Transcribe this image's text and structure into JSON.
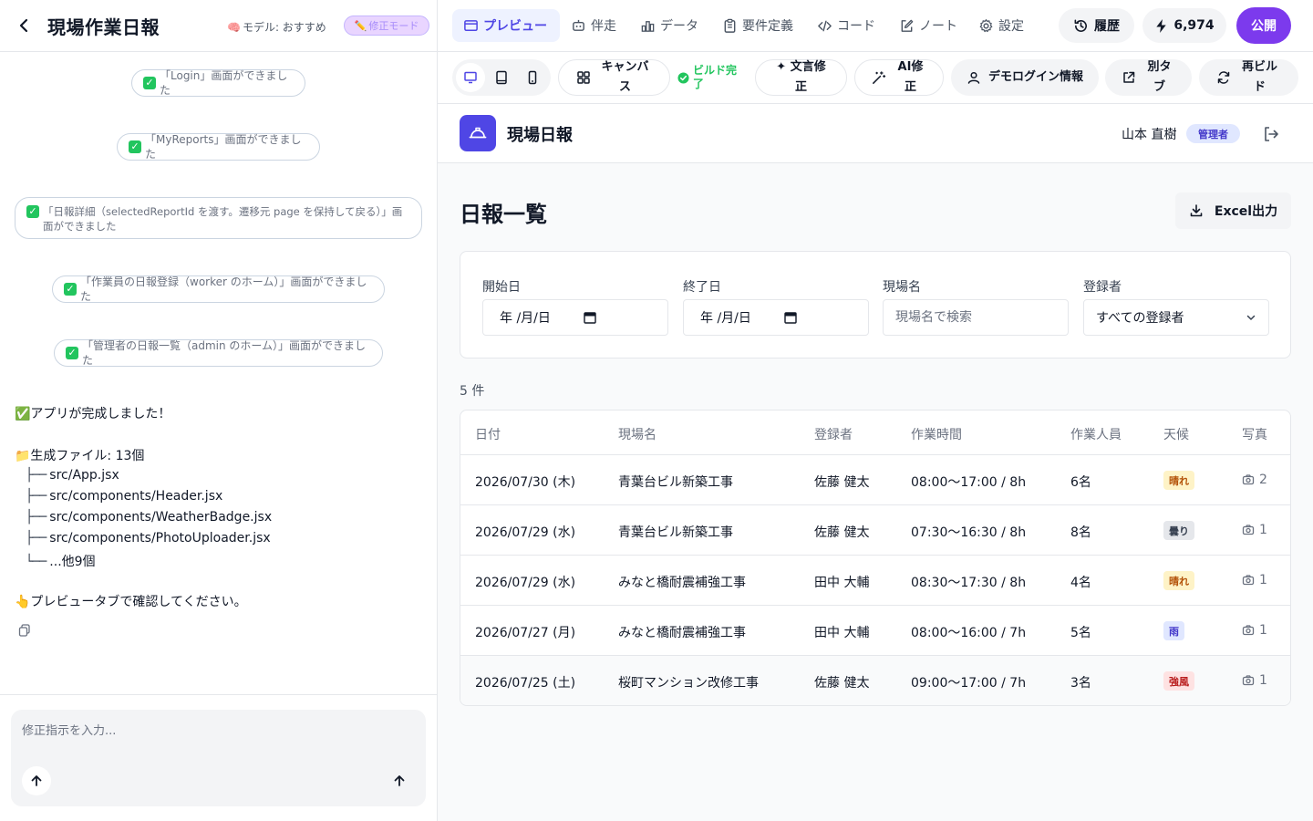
{
  "left": {
    "title": "現場作業日報",
    "model_label": "モデル: おすすめ",
    "fix_mode_label": "修正モード",
    "chat": {
      "pills": [
        "「Login」画面ができました",
        "「MyReports」画面ができました",
        "「日報詳細（selectedReportId を渡す。遷移元 page を保持して戻る）」画面ができました",
        "「作業員の日報登録（worker のホーム）」画面ができました",
        "「管理者の日報一覧（admin のホーム）」画面ができました"
      ],
      "complete": "✅アプリが完成しました！",
      "generated": "📁生成ファイル: 13個",
      "files": [
        "src/App.jsx",
        "src/components/Header.jsx",
        "src/components/WeatherBadge.jsx",
        "src/components/PhotoUploader.jsx",
        "...他9個"
      ],
      "hint": "👆プレビュータブで確認してください。"
    },
    "composer": {
      "placeholder": "修正指示を入力..."
    }
  },
  "topnav": {
    "tabs": [
      "プレビュー",
      "伴走",
      "データ",
      "要件定義",
      "コード",
      "ノート",
      "設定"
    ],
    "history_label": "履歴",
    "credits": "6,974",
    "publish_label": "公開"
  },
  "toolbar": {
    "canvas_label": "キャンバス",
    "build_status": "ビルド完了",
    "copy_fix_label": "文言修正",
    "ai_fix_label": "AI修正",
    "demo_login_label": "デモログイン情報",
    "new_tab_label": "別タブ",
    "rebuild_label": "再ビルド"
  },
  "app": {
    "name": "現場日報",
    "user_name": "山本 直樹",
    "role": "管理者",
    "page_title": "日報一覧",
    "excel_label": "Excel出力",
    "filters": {
      "start_label": "開始日",
      "start_value": "年 /月/日",
      "end_label": "終了日",
      "end_value": "年 /月/日",
      "site_label": "現場名",
      "site_placeholder": "現場名で検索",
      "registrant_label": "登録者",
      "registrant_value": "すべての登録者"
    },
    "count": "5 件",
    "columns": [
      "日付",
      "現場名",
      "登録者",
      "作業時間",
      "作業人員",
      "天候",
      "写真"
    ],
    "rows": [
      {
        "date": "2026/07/30 (木)",
        "site": "青葉台ビル新築工事",
        "person": "佐藤 健太",
        "time": "08:00〜17:00 / 8h",
        "workers": "6名",
        "weather": "晴れ",
        "photos": "2"
      },
      {
        "date": "2026/07/29 (水)",
        "site": "青葉台ビル新築工事",
        "person": "佐藤 健太",
        "time": "07:30〜16:30 / 8h",
        "workers": "8名",
        "weather": "曇り",
        "photos": "1"
      },
      {
        "date": "2026/07/29 (水)",
        "site": "みなと橋耐震補強工事",
        "person": "田中 大輔",
        "time": "08:30〜17:30 / 8h",
        "workers": "4名",
        "weather": "晴れ",
        "photos": "1"
      },
      {
        "date": "2026/07/27 (月)",
        "site": "みなと橋耐震補強工事",
        "person": "田中 大輔",
        "time": "08:00〜16:00 / 7h",
        "workers": "5名",
        "weather": "雨",
        "photos": "1"
      },
      {
        "date": "2026/07/25 (土)",
        "site": "桜町マンション改修工事",
        "person": "佐藤 健太",
        "time": "09:00〜17:00 / 7h",
        "workers": "3名",
        "weather": "強風",
        "photos": "1"
      }
    ]
  },
  "colors": {
    "accent": "#4f46e5",
    "publish": "#7c3aed",
    "success": "#22c55e",
    "weather_sunny_bg": "#fef3c7",
    "weather_sunny_fg": "#b45309",
    "weather_cloudy_bg": "#e5e7eb",
    "weather_cloudy_fg": "#374151",
    "weather_rain_bg": "#e0e7ff",
    "weather_rain_fg": "#4338ca",
    "weather_wind_bg": "#fee2e2",
    "weather_wind_fg": "#b91c1c"
  },
  "icons": [
    "back-arrow-icon",
    "brain-icon",
    "pencil-icon",
    "monitor-icon",
    "robot-icon",
    "chart-icon",
    "clipboard-icon",
    "code-icon",
    "edit-note-icon",
    "gear-icon",
    "history-icon",
    "bolt-icon",
    "desktop-icon",
    "tablet-icon",
    "phone-icon",
    "grid-icon",
    "check-circle-icon",
    "sparkle-icon",
    "wand-icon",
    "user-icon",
    "external-link-icon",
    "refresh-icon",
    "helmet-icon",
    "logout-icon",
    "download-icon",
    "calendar-icon",
    "chevron-down-icon",
    "camera-icon",
    "copy-icon",
    "arrow-up-icon"
  ]
}
